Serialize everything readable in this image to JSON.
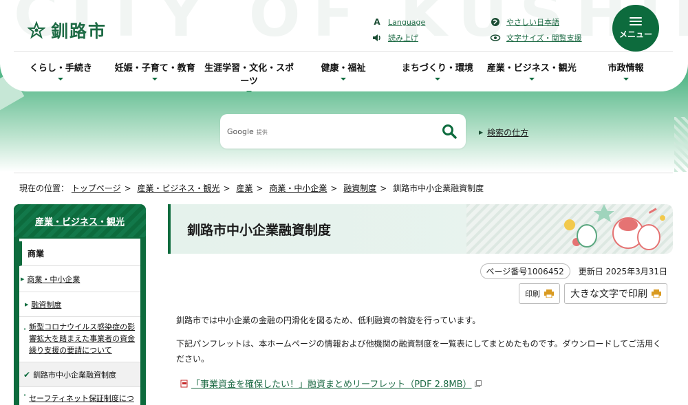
{
  "header": {
    "watermark": "CITY OF KUSHIRO",
    "logo_text": "釧路市",
    "links": {
      "language": "Language",
      "read_aloud": "読み上げ",
      "easy_japanese": "やさしい日本語",
      "text_size": "文字サイズ・閲覧支援"
    },
    "menu_label": "メニュー"
  },
  "nav": {
    "items": [
      {
        "label": "くらし・手続き"
      },
      {
        "label": "妊娠・子育て・教育"
      },
      {
        "label": "生涯学習・文化・スポーツ"
      },
      {
        "label": "健康・福祉"
      },
      {
        "label": "まちづくり・環境"
      },
      {
        "label": "産業・ビジネス・観光"
      },
      {
        "label": "市政情報"
      }
    ]
  },
  "search": {
    "brand": "Google",
    "brand_suffix": "提供",
    "help_link": "検索の仕方"
  },
  "breadcrumb": {
    "prefix": "現在の位置：",
    "items": [
      "トップページ",
      "産業・ビジネス・観光",
      "産業",
      "商業・中小企業",
      "融資制度"
    ],
    "current": "釧路市中小企業融資制度"
  },
  "sidebar": {
    "heading": "産業・ビジネス・観光",
    "category": "商業",
    "items": [
      {
        "label": "商業・中小企業"
      },
      {
        "label": "融資制度"
      },
      {
        "label": "新型コロナウイルス感染症の影響拡大を踏まえた事業者の資金繰り支援の要請について"
      },
      {
        "label": "釧路市中小企業融資制度"
      },
      {
        "label": "セーフティネット保証制度につい"
      }
    ]
  },
  "main": {
    "title": "釧路市中小企業融資制度",
    "page_number": "ページ番号1006452",
    "updated": "更新日 2025年3月31日",
    "print_label": "印刷",
    "print_large_label": "大きな文字で印刷",
    "paragraph1": "釧路市では中小企業の金融の円滑化を図るため、低利融資の斡旋を行っています。",
    "paragraph2": "下記パンフレットは、本ホームページの情報および他機関の融資制度を一覧表にしてまとめたものです。ダウンロードしてご活用ください。",
    "pdf_link": "「事業資金を確保したい！」融資まとめリーフレット（PDF 2.8MB）"
  },
  "colors": {
    "brand_green": "#0d6b3d",
    "hero_green": "#2e9f6f"
  }
}
